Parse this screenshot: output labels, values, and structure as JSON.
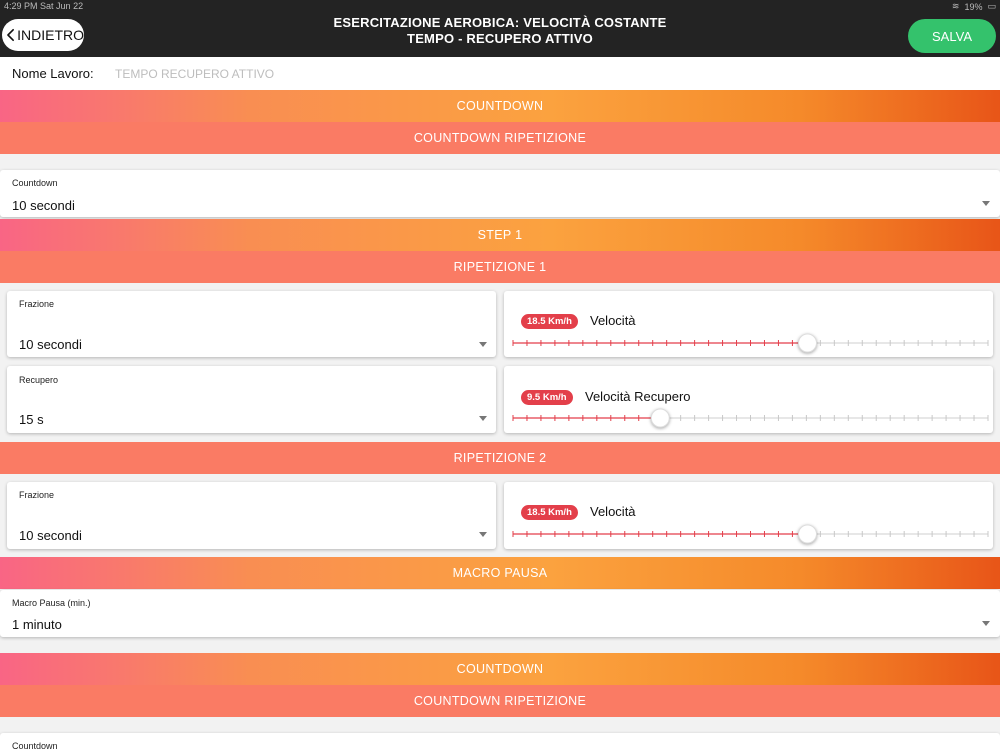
{
  "status_bar": {
    "time": "4:29 PM",
    "date": "Sat Jun 22",
    "battery": "19%"
  },
  "nav": {
    "back_label": "INDIETRO",
    "title_line1": "ESERCITAZIONE AEROBICA: VELOCITÀ COSTANTE",
    "title_line2": "TEMPO - RECUPERO ATTIVO",
    "save_label": "SALVA"
  },
  "job": {
    "label": "Nome Lavoro:",
    "placeholder": "TEMPO RECUPERO ATTIVO",
    "value": ""
  },
  "sections": {
    "countdown_header": "COUNTDOWN",
    "countdown_repeat_header": "COUNTDOWN RIPETIZIONE",
    "countdown_caption": "Countdown",
    "countdown_value": "10 secondi",
    "step_header": "STEP 1",
    "rep1_header": "RIPETIZIONE 1",
    "rep2_header": "RIPETIZIONE 2",
    "macro_header": "MACRO PAUSA",
    "macro_caption": "Macro Pausa (min.)",
    "macro_value": "1 minuto",
    "countdown2_header": "COUNTDOWN",
    "countdown2_repeat_header": "COUNTDOWN RIPETIZIONE",
    "countdown2_caption": "Countdown"
  },
  "rep1": {
    "frazione_caption": "Frazione",
    "frazione_value": "10 secondi",
    "recupero_caption": "Recupero",
    "recupero_value": "15 s",
    "speed_badge": "18.5 Km/h",
    "speed_label": "Velocità",
    "speed_fraction": 0.62,
    "recovery_badge": "9.5 Km/h",
    "recovery_label": "Velocità Recupero",
    "recovery_fraction": 0.31
  },
  "rep2": {
    "frazione_caption": "Frazione",
    "frazione_value": "10 secondi",
    "speed_badge": "18.5 Km/h",
    "speed_label": "Velocità",
    "speed_fraction": 0.62
  },
  "colors": {
    "accent_red": "#e33f4a",
    "save_green": "#34c26c",
    "band_solid": "#fa7b64"
  }
}
